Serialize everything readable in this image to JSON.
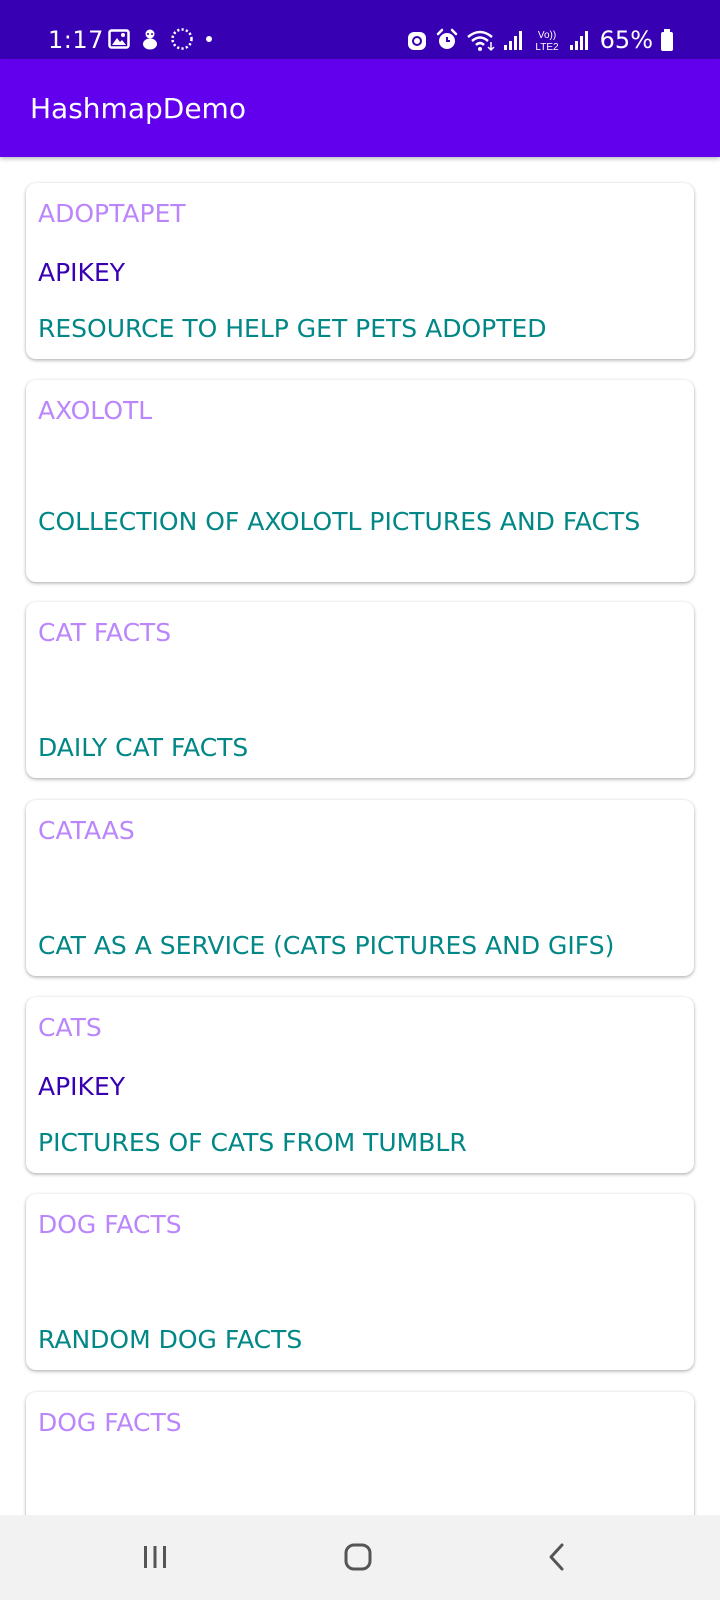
{
  "status_bar": {
    "time": "1:17",
    "battery": "65%",
    "network_badge_top": "Vo))",
    "network_badge_bottom": "LTE2"
  },
  "app_bar": {
    "title": "HashmapDemo"
  },
  "items": [
    {
      "title": "AdoptAPet",
      "auth": "apiKey",
      "description": "Resource to help get pets adopted"
    },
    {
      "title": "Axolotl",
      "auth": "",
      "description": "Collection of axolotl pictures and facts"
    },
    {
      "title": "Cat Facts",
      "auth": "",
      "description": "Daily cat facts"
    },
    {
      "title": "Cataas",
      "auth": "",
      "description": "Cat as a service (cats pictures and gifs)"
    },
    {
      "title": "Cats",
      "auth": "apiKey",
      "description": "Pictures of cats from Tumblr"
    },
    {
      "title": "Dog Facts",
      "auth": "",
      "description": "Random dog facts"
    },
    {
      "title": "Dog Facts",
      "auth": "",
      "description": ""
    }
  ],
  "colors": {
    "status_bar": "#3700b3",
    "app_bar": "#6200ee",
    "title_text": "#bb86fc",
    "auth_text": "#3700b3",
    "description_text": "#018786"
  },
  "nav_icons": [
    "recent-apps-icon",
    "home-icon",
    "back-icon"
  ]
}
